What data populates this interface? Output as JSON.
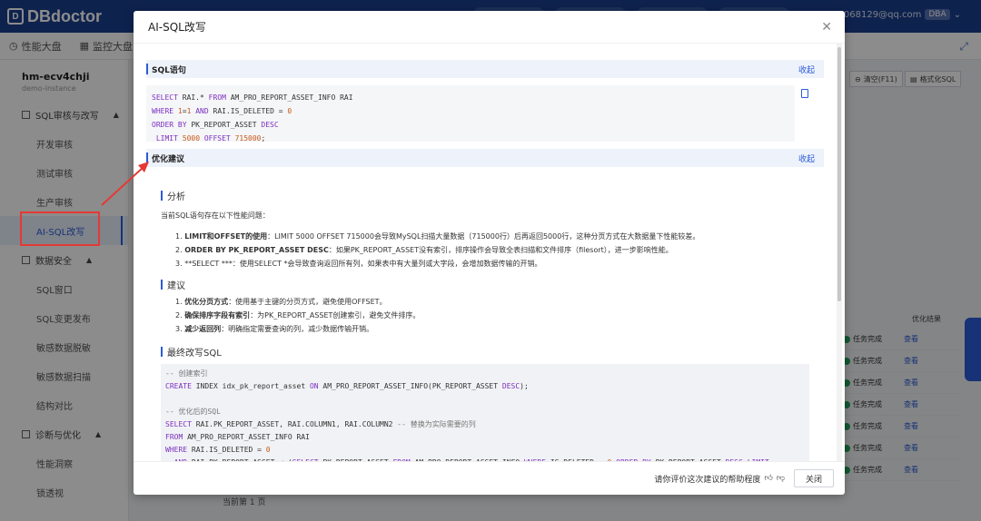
{
  "app": {
    "brand": "DBdoctor",
    "user_email": "690068129@qq.com",
    "role_badge": "DBA"
  },
  "toolbar": {
    "tabs": [
      "性能大盘",
      "监控大盘"
    ]
  },
  "sidebar": {
    "instance_name": "hm-ecv4chji",
    "instance_sub": "demo-instance",
    "groups": [
      {
        "label": "SQL审核与改写",
        "items": [
          "开发审核",
          "测试审核",
          "生产审核",
          "AI-SQL改写"
        ]
      },
      {
        "label": "数据安全",
        "items": [
          "SQL窗口",
          "SQL变更发布",
          "敏感数据脱敏",
          "敏感数据扫描",
          "结构对比"
        ]
      },
      {
        "label": "诊断与优化",
        "items": [
          "性能洞察",
          "锁透视"
        ]
      }
    ]
  },
  "background": {
    "clear_btn": "清空(F11)",
    "format_btn": "格式化SQL",
    "table_header": "优化结果",
    "status_done": "任务完成",
    "view_link": "查看",
    "pager_text": "当前第 1 页"
  },
  "modal": {
    "title": "AI-SQL改写",
    "sql_section": "SQL语句",
    "collapse": "收起",
    "sql_lines": [
      "SELECT RAI.* FROM AM_PRO_REPORT_ASSET_INFO RAI",
      "WHERE 1=1 AND RAI.IS_DELETED = 0",
      "ORDER BY PK_REPORT_ASSET DESC",
      " LIMIT 5000 OFFSET 715000;"
    ],
    "advice_section": "优化建议",
    "analysis_title": "分析",
    "analysis_intro": "当前SQL语句存在以下性能问题：",
    "analysis_items": [
      {
        "bold": "LIMIT和OFFSET的使用",
        "text": "：LIMIT 5000 OFFSET 715000会导致MySQL扫描大量数据（715000行）后再返回5000行，这种分页方式在大数据量下性能较差。"
      },
      {
        "bold": "ORDER BY PK_REPORT_ASSET DESC",
        "text": "：如果PK_REPORT_ASSET没有索引，排序操作会导致全表扫描和文件排序（filesort），进一步影响性能。"
      },
      {
        "bold": "",
        "text": "**SELECT ***：使用SELECT *会导致查询返回所有列，如果表中有大量列或大字段，会增加数据传输的开销。"
      }
    ],
    "suggest_title": "建议",
    "suggest_items": [
      {
        "bold": "优化分页方式",
        "text": "：使用基于主键的分页方式，避免使用OFFSET。"
      },
      {
        "bold": "确保排序字段有索引",
        "text": "：为PK_REPORT_ASSET创建索引，避免文件排序。"
      },
      {
        "bold": "减少返回列",
        "text": "：明确指定需要查询的列，减少数据传输开销。"
      }
    ],
    "final_title": "最终改写SQL",
    "final_sql": [
      "-- 创建索引",
      "CREATE INDEX idx_pk_report_asset ON AM_PRO_REPORT_ASSET_INFO(PK_REPORT_ASSET DESC);",
      "",
      "-- 优化后的SQL",
      "SELECT RAI.PK_REPORT_ASSET, RAI.COLUMN1, RAI.COLUMN2 -- 替换为实际需要的列",
      "FROM AM_PRO_REPORT_ASSET_INFO RAI",
      "WHERE RAI.IS_DELETED = 0",
      "  AND RAI.PK_REPORT_ASSET < (SELECT PK_REPORT_ASSET FROM AM_PRO_REPORT_ASSET_INFO WHERE IS_DELETED = 0 ORDER BY PK_REPORT_ASSET DESC LIMIT"
    ],
    "feedback_text": "请你评价这次建议的帮助程度",
    "close_btn": "关闭"
  },
  "colors": {
    "brand_blue": "#1a3f8f",
    "accent": "#2b5bd7",
    "annotation_red": "#e53935",
    "success": "#21a35b"
  }
}
